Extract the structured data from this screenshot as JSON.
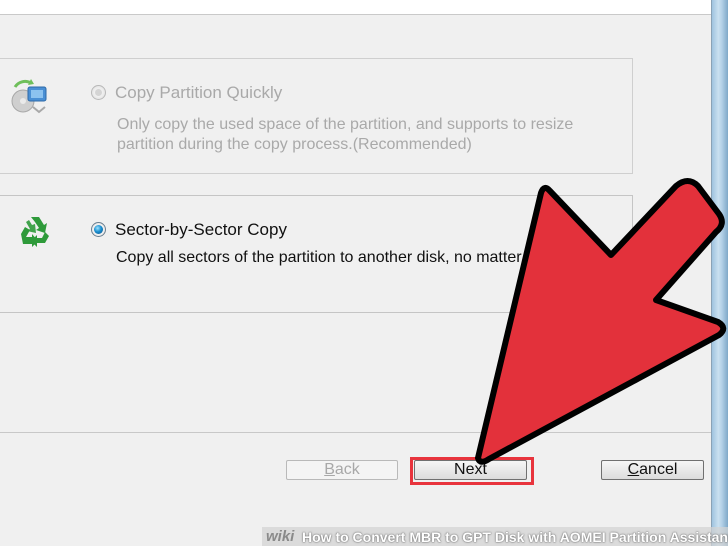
{
  "options": [
    {
      "title": "Copy Partition Quickly",
      "description": "Only copy the used space of the partition, and supports to resize partition during the copy process.(Recommended)",
      "selected": false,
      "enabled": false,
      "icon": "copy-partition-icon"
    },
    {
      "title": "Sector-by-Sector Copy",
      "description": "Copy all sectors of the partition to another disk, no matter used or not.",
      "selected": true,
      "enabled": true,
      "icon": "recycle-icon"
    }
  ],
  "buttons": {
    "back": "Back",
    "next": "Next",
    "cancel": "Cancel"
  },
  "banner": {
    "brand": "wiki",
    "title": "How to Convert MBR to GPT Disk with AOMEI Partition Assistant"
  },
  "colors": {
    "arrow": "#e3313b",
    "highlight": "#e8343d",
    "radio_selected": "#1a8fd0"
  }
}
